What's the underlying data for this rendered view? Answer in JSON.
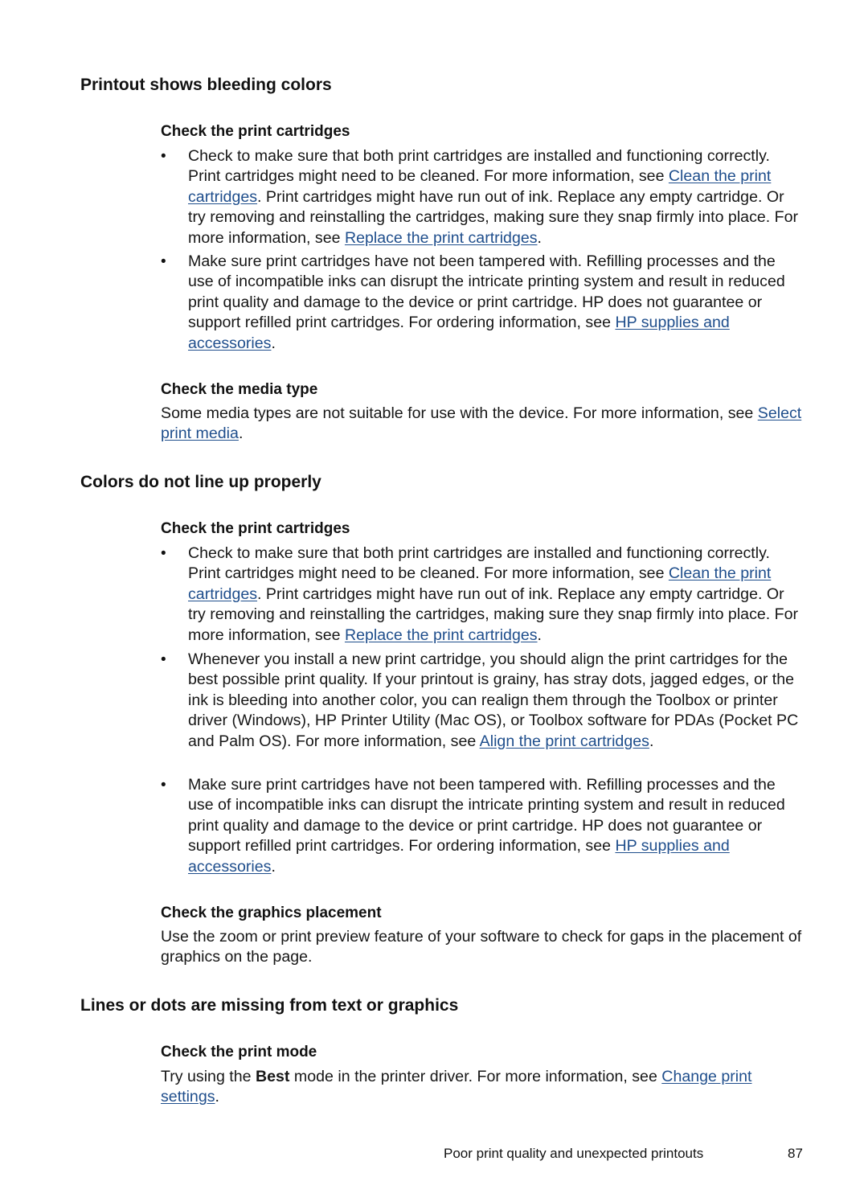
{
  "sections": [
    {
      "heading": "Printout shows bleeding colors",
      "subsections": [
        {
          "heading": "Check the print cartridges",
          "bullets": [
            {
              "pre": "Check to make sure that both print cartridges are installed and functioning correctly. Print cartridges might need to be cleaned. For more information, see ",
              "link1": "Clean the print cartridges",
              "mid": ". Print cartridges might have run out of ink. Replace any empty cartridge. Or try removing and reinstalling the cartridges, making sure they snap firmly into place. For more information, see ",
              "link2": "Replace the print cartridges",
              "post": "."
            },
            {
              "pre": "Make sure print cartridges have not been tampered with. Refilling processes and the use of incompatible inks can disrupt the intricate printing system and result in reduced print quality and damage to the device or print cartridge. HP does not guarantee or support refilled print cartridges. For ordering information, see ",
              "link1": "HP supplies and accessories",
              "post": "."
            }
          ]
        },
        {
          "heading": "Check the media type",
          "para": {
            "pre": "Some media types are not suitable for use with the device. For more information, see ",
            "link1": "Select print media",
            "post": "."
          }
        }
      ]
    },
    {
      "heading": "Colors do not line up properly",
      "subsections": [
        {
          "heading": "Check the print cartridges",
          "bullets": [
            {
              "pre": "Check to make sure that both print cartridges are installed and functioning correctly. Print cartridges might need to be cleaned. For more information, see ",
              "link1": "Clean the print cartridges",
              "mid": ". Print cartridges might have run out of ink. Replace any empty cartridge. Or try removing and reinstalling the cartridges, making sure they snap firmly into place. For more information, see ",
              "link2": "Replace the print cartridges",
              "post": "."
            },
            {
              "pre": "Whenever you install a new print cartridge, you should align the print cartridges for the best possible print quality. If your printout is grainy, has stray dots, jagged edges, or the ink is bleeding into another color, you can realign them through the Toolbox or printer driver (Windows), HP Printer Utility (Mac OS), or Toolbox software for PDAs (Pocket PC and Palm OS). For more information, see ",
              "link1": "Align the print cartridges",
              "post": "."
            },
            {
              "pre": "Make sure print cartridges have not been tampered with. Refilling processes and the use of incompatible inks can disrupt the intricate printing system and result in reduced print quality and damage to the device or print cartridge. HP does not guarantee or support refilled print cartridges. For ordering information, see ",
              "link1": "HP supplies and accessories",
              "post": "."
            }
          ]
        },
        {
          "heading": "Check the graphics placement",
          "para": {
            "pre": "Use the zoom or print preview feature of your software to check for gaps in the placement of graphics on the page."
          }
        }
      ]
    },
    {
      "heading": "Lines or dots are missing from text or graphics",
      "subsections": [
        {
          "heading": "Check the print mode",
          "para": {
            "pre": "Try using the ",
            "bold": "Best",
            "mid": " mode in the printer driver. For more information, see ",
            "link1": "Change print settings",
            "post": "."
          }
        }
      ]
    }
  ],
  "bullet_glyph": "•",
  "footer": {
    "title": "Poor print quality and unexpected printouts",
    "page_number": "87"
  },
  "colors": {
    "link": "#1f4e8c",
    "text": "#161616"
  }
}
